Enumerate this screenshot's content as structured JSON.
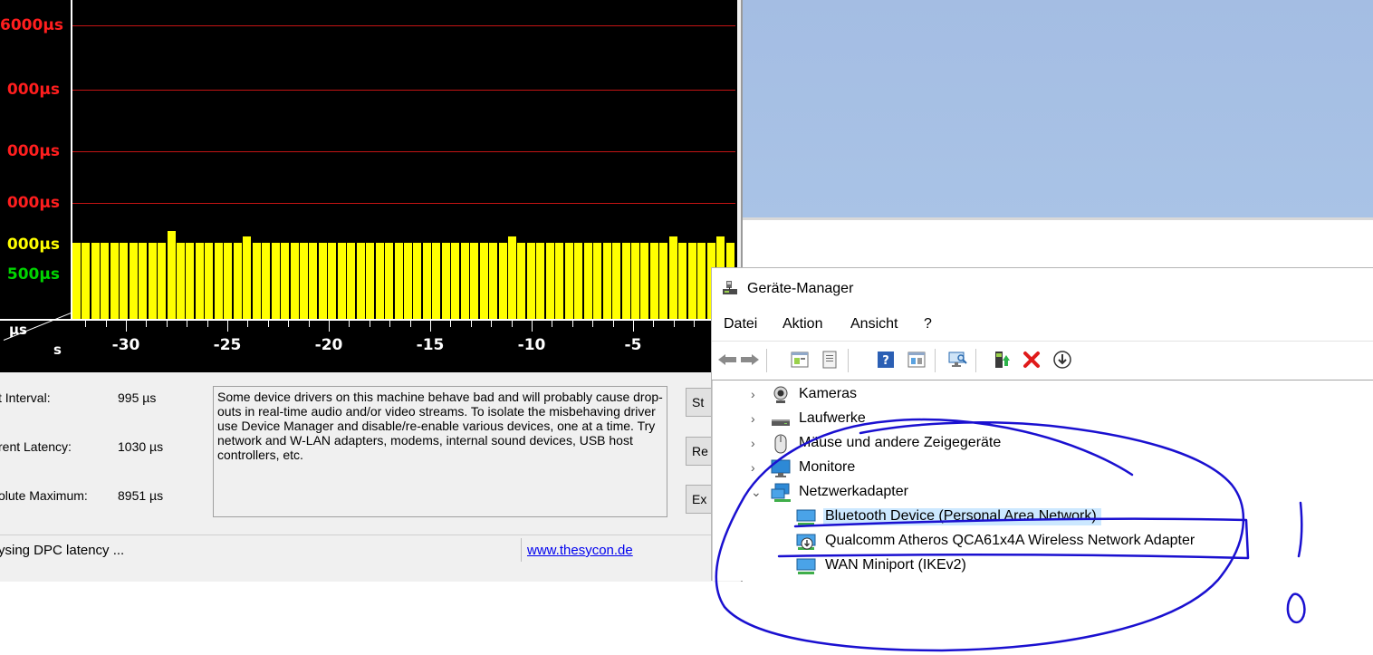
{
  "dpc": {
    "y_labels": [
      {
        "text": "6000µs",
        "color": "red"
      },
      {
        "text": "000µs",
        "color": "red"
      },
      {
        "text": "000µs",
        "color": "red"
      },
      {
        "text": "000µs",
        "color": "red"
      },
      {
        "text": "000µs",
        "color": "yellow"
      },
      {
        "text": "500µs",
        "color": "green"
      }
    ],
    "x_labels": [
      "-30",
      "-25",
      "-20",
      "-15",
      "-10",
      "-5"
    ],
    "unit_top": "µs",
    "unit_bottom": "s",
    "bars_relative_height": [
      1,
      1,
      1,
      1,
      1,
      1,
      1,
      1,
      1,
      1,
      1.15,
      1,
      1,
      1,
      1,
      1,
      1,
      1,
      1.08,
      1,
      1,
      1,
      1,
      1,
      1,
      1,
      1,
      1,
      1,
      1,
      1,
      1,
      1,
      1,
      1,
      1,
      1,
      1,
      1,
      1,
      1,
      1,
      1,
      1,
      1,
      1,
      1.08,
      1,
      1,
      1,
      1,
      1,
      1,
      1,
      1,
      1,
      1,
      1,
      1,
      1,
      1,
      1,
      1,
      1.08,
      1,
      1,
      1,
      1,
      1.08,
      1
    ],
    "colors": {
      "background": "#000000",
      "bars": "#ffff00",
      "grid": "#c41414"
    },
    "stats": {
      "interval_label": "t Interval:",
      "interval_value": "995 µs",
      "current_label": "rent Latency:",
      "current_value": "1030 µs",
      "maximum_label": "olute Maximum:",
      "maximum_value": "8951 µs"
    },
    "message": "Some device drivers on this machine behave bad and will probably cause drop-outs in real-time audio and/or video streams. To isolate the misbehaving driver use Device Manager and disable/re-enable various devices, one at a time. Try network and W-LAN adapters, modems, internal sound devices, USB host controllers, etc.",
    "buttons": {
      "start": "St",
      "reset": "Re",
      "exit": "Ex"
    },
    "status": "ysing DPC latency ...",
    "link": "www.thesycon.de"
  },
  "devmgr": {
    "title": "Geräte-Manager",
    "menu": [
      "Datei",
      "Aktion",
      "Ansicht",
      "?"
    ],
    "toolbar_icons": [
      "back-icon",
      "forward-icon",
      "properties-icon",
      "show-hidden-icon",
      "help-icon",
      "view-icon",
      "scan-hardware-icon",
      "update-driver-icon",
      "uninstall-icon",
      "enable-device-icon"
    ],
    "tree": [
      {
        "label": "Kameras",
        "icon": "camera-icon",
        "expanded": false,
        "level": 0
      },
      {
        "label": "Laufwerke",
        "icon": "disk-drive-icon",
        "expanded": false,
        "level": 0
      },
      {
        "label": "Mäuse und andere Zeigegeräte",
        "icon": "mouse-icon",
        "expanded": false,
        "level": 0
      },
      {
        "label": "Monitore",
        "icon": "monitor-icon",
        "expanded": false,
        "level": 0
      },
      {
        "label": "Netzwerkadapter",
        "icon": "network-icon",
        "expanded": true,
        "level": 0
      },
      {
        "label": "Bluetooth Device (Personal Area Network)",
        "icon": "network-adapter-icon",
        "level": 1,
        "selected": true
      },
      {
        "label": "Qualcomm Atheros QCA61x4A Wireless Network Adapter",
        "icon": "network-adapter-disabled-icon",
        "level": 1
      },
      {
        "label": "WAN Miniport (IKEv2)",
        "icon": "network-adapter-icon",
        "level": 1
      }
    ]
  },
  "annotation": {
    "ink_color": "#1a10d0",
    "marks": "!0"
  }
}
